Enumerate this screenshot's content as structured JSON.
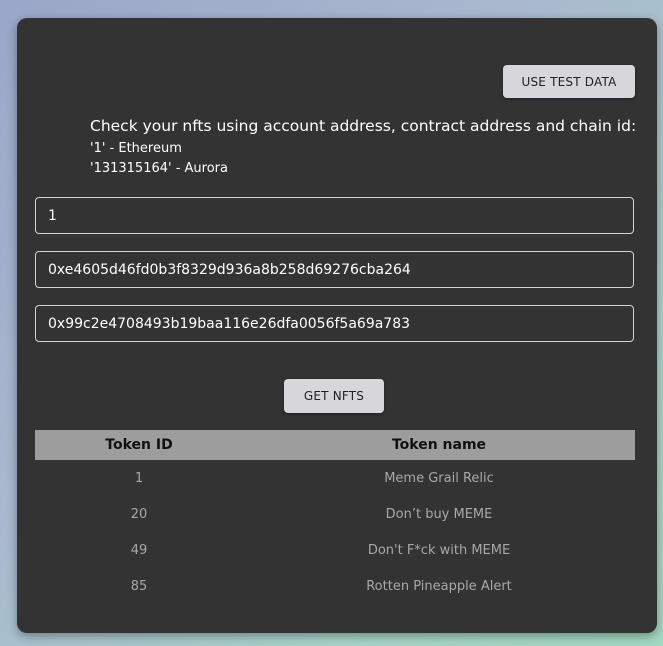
{
  "buttons": {
    "use_test_data": "USE TEST DATA",
    "get_nfts": "GET NFTS"
  },
  "intro": {
    "title": "Check your nfts using account address, contract address and chain id:",
    "chain_hint_1": "'1' - Ethereum",
    "chain_hint_2": "'131315164' - Aurora"
  },
  "fields": {
    "chain_id": "1",
    "account_address": "0xe4605d46fd0b3f8329d936a8b258d69276cba264",
    "contract_address": "0x99c2e4708493b19baa116e26dfa0056f5a69a783"
  },
  "table": {
    "headers": {
      "token_id": "Token ID",
      "token_name": "Token name"
    },
    "rows": [
      {
        "id": "1",
        "name": "Meme Grail Relic"
      },
      {
        "id": "20",
        "name": "Don’t buy MEME"
      },
      {
        "id": "49",
        "name": "Don't F*ck with MEME"
      },
      {
        "id": "85",
        "name": "Rotten Pineapple Alert"
      }
    ]
  },
  "colors": {
    "card": "#333333",
    "button": "#d7d6db",
    "table_header": "#9d9d9d",
    "cell_text": "#a8a8a8"
  }
}
